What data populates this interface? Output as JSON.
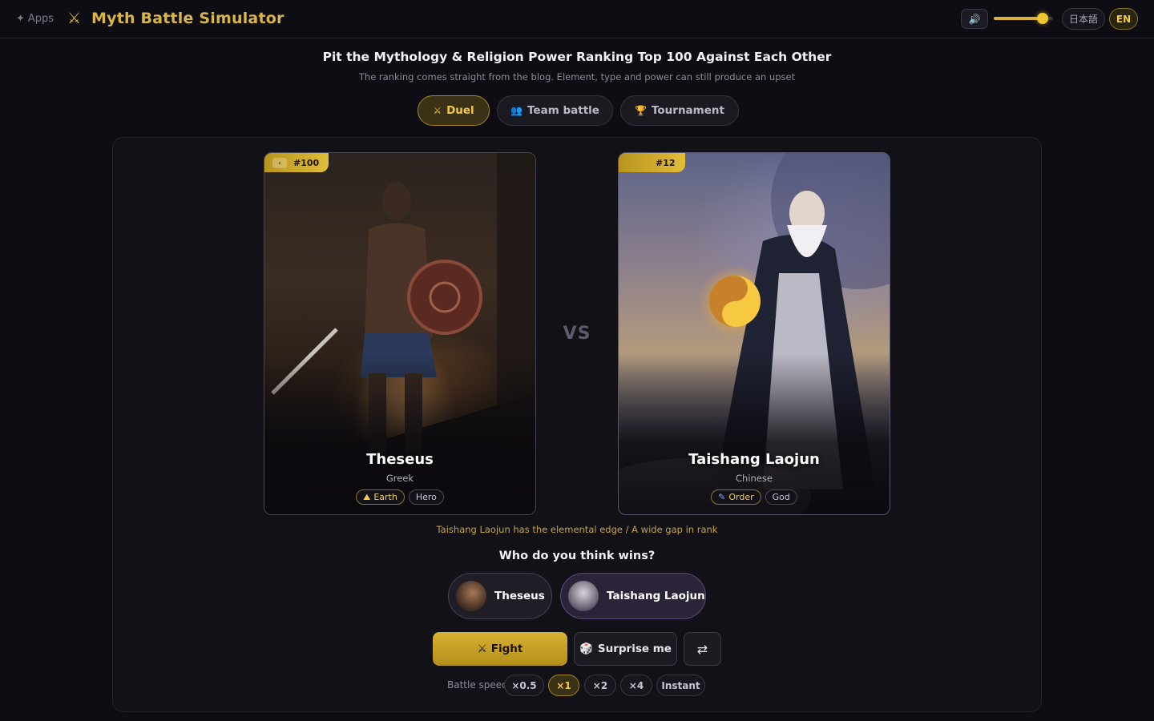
{
  "header": {
    "apps_label": "Apps",
    "app_title": "Myth Battle Simulator",
    "volume_level": 0.82,
    "languages": [
      "日本語",
      "EN"
    ],
    "active_language": "EN"
  },
  "hero": {
    "headline": "Pit the Mythology & Religion Power Ranking Top 100 Against Each Other",
    "subline": "The ranking comes straight from the blog. Element, type and power can still produce an upset"
  },
  "modes": [
    {
      "label": "Duel",
      "icon": "crossed-swords-icon",
      "active": true
    },
    {
      "label": "Team battle",
      "icon": "people-icon",
      "active": false
    },
    {
      "label": "Tournament",
      "icon": "trophy-icon",
      "active": false
    }
  ],
  "fighters": {
    "left": {
      "rank": "#100",
      "name": "Theseus",
      "origin": "Greek",
      "element": "Earth",
      "type": "Hero"
    },
    "right": {
      "rank": "#12",
      "name": "Taishang Laojun",
      "origin": "Chinese",
      "element": "Order",
      "type": "God"
    }
  },
  "vs_label": "VS",
  "edge_note": "Taishang Laojun has the elemental edge / A wide gap in rank",
  "prediction": {
    "question": "Who do you think wins?",
    "options": [
      "Theseus",
      "Taishang Laojun"
    ]
  },
  "actions": {
    "fight": "Fight",
    "surprise": "Surprise me",
    "swap_icon": "swap-icon"
  },
  "speed": {
    "label": "Battle speed",
    "options": [
      "×0.5",
      "×1",
      "×2",
      "×4",
      "Instant"
    ],
    "selected": "×1"
  },
  "colors": {
    "accent": "#d8b13a",
    "background": "#0e0d13"
  }
}
